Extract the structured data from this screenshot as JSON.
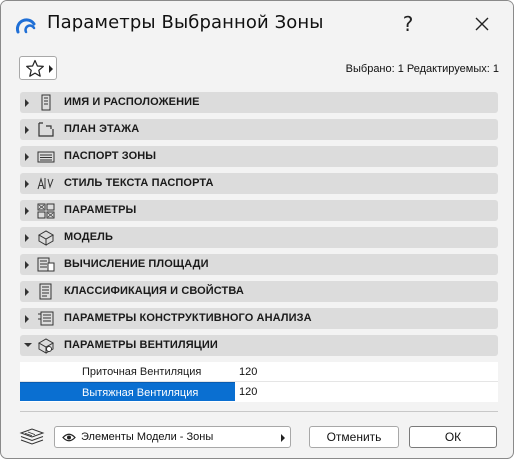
{
  "window": {
    "title": "Параметры Выбранной Зоны",
    "help_label": "?"
  },
  "toolbar": {
    "selection_info": "Выбрано: 1 Редактируемых: 1"
  },
  "panels": [
    {
      "label": "ИМЯ И РАСПОЛОЖЕНИЕ",
      "icon": "name-location-icon",
      "expanded": false
    },
    {
      "label": "ПЛАН ЭТАЖА",
      "icon": "floor-plan-icon",
      "expanded": false
    },
    {
      "label": "ПАСПОРТ ЗОНЫ",
      "icon": "zone-stamp-icon",
      "expanded": false
    },
    {
      "label": "СТИЛЬ ТЕКСТА ПАСПОРТА",
      "icon": "text-style-icon",
      "expanded": false
    },
    {
      "label": "ПАРАМЕТРЫ",
      "icon": "parameters-icon",
      "expanded": false
    },
    {
      "label": "МОДЕЛЬ",
      "icon": "model-icon",
      "expanded": false
    },
    {
      "label": "ВЫЧИСЛЕНИЕ ПЛОЩАДИ",
      "icon": "area-calculation-icon",
      "expanded": false
    },
    {
      "label": "КЛАССИФИКАЦИЯ И СВОЙСТВА",
      "icon": "classification-icon",
      "expanded": false
    },
    {
      "label": "ПАРАМЕТРЫ КОНСТРУКТИВНОГО АНАЛИЗА",
      "icon": "structural-analysis-icon",
      "expanded": false
    },
    {
      "label": "ПАРАМЕТРЫ ВЕНТИЛЯЦИИ",
      "icon": "ventilation-icon",
      "expanded": true
    }
  ],
  "ventilation": {
    "rows": [
      {
        "name": "Приточная Вентиляция",
        "value": "120",
        "selected": false
      },
      {
        "name": "Вытяжная Вентиляция",
        "value": "120",
        "selected": true
      }
    ]
  },
  "footer": {
    "view_select": "Элементы Модели - Зоны",
    "cancel_label": "Отменить",
    "ok_label": "ОК"
  },
  "colors": {
    "accent": "#0a6fd1",
    "panel_bg": "#dcdcdc",
    "dialog_bg": "#f3f3f3"
  }
}
